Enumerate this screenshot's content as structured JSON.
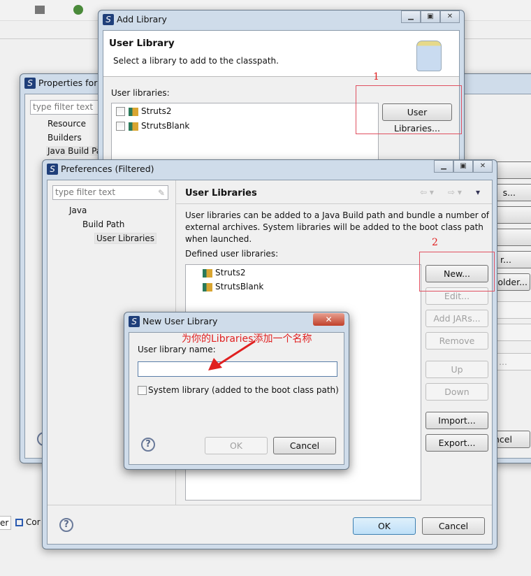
{
  "properties": {
    "title": "Properties for",
    "filter_placeholder": "type filter text",
    "tree": [
      "Resource",
      "Builders",
      "Java Build Pa"
    ],
    "partial_buttons": [
      "s...",
      "r...",
      "older...",
      "..."
    ],
    "cancel_partial": "ncel"
  },
  "add_library": {
    "title": "Add Library",
    "header": "User Library",
    "description": "Select a library to add to the classpath.",
    "list_label": "User libraries:",
    "libraries": [
      "Struts2",
      "StrutsBlank"
    ],
    "user_libraries_button": "User Libraries...",
    "step_label": "1"
  },
  "preferences": {
    "title": "Preferences (Filtered)",
    "filter_placeholder": "type filter text",
    "tree": [
      "Java",
      "Build Path",
      "User Libraries"
    ],
    "page_title": "User Libraries",
    "description": "User libraries can be added to a Java Build path and bundle a number of external archives. System libraries will be added to the boot class path when launched.",
    "defined_label": "Defined user libraries:",
    "libraries": [
      "Struts2",
      "StrutsBlank"
    ],
    "buttons": {
      "new": "New...",
      "edit": "Edit...",
      "add_jars": "Add JARs...",
      "remove": "Remove",
      "up": "Up",
      "down": "Down",
      "import": "Import...",
      "export": "Export..."
    },
    "ok": "OK",
    "cancel": "Cancel",
    "step_label": "2"
  },
  "new_user_library": {
    "title": "New User Library",
    "name_label": "User library name:",
    "name_value": "",
    "system_checkbox": "System library (added to the boot class path)",
    "system_checked": false,
    "ok": "OK",
    "cancel": "Cancel",
    "annotation": "为你的Libraries添加一个名称"
  },
  "bottom_tabs": [
    "er",
    "Cor"
  ],
  "colors": {
    "annotation": "#e02020",
    "title_bar": "#cfdcea",
    "default_button": "#bfe0f8"
  }
}
